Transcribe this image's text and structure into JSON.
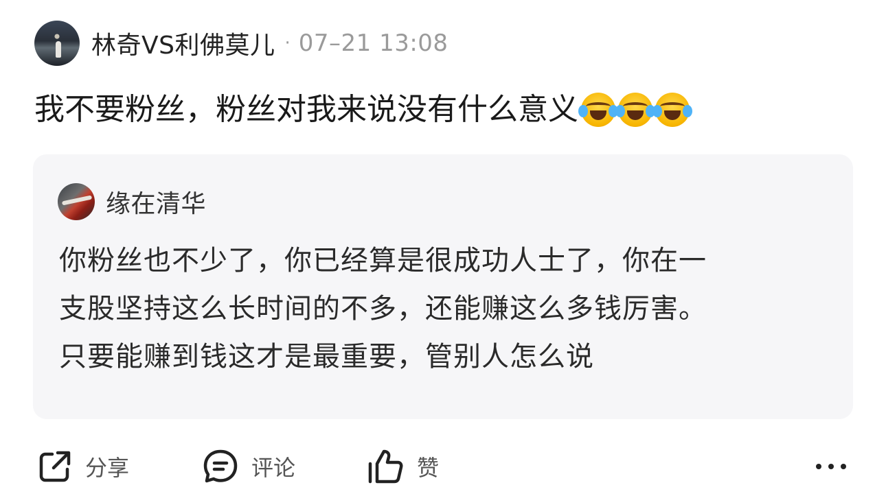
{
  "post": {
    "author": "林奇VS利佛莫儿",
    "separator": "·",
    "timestamp": "07–21 13:08",
    "text": "我不要粉丝，粉丝对我来说没有什么意义",
    "emojis": [
      "laughing-crying-emoji",
      "laughing-crying-emoji",
      "laughing-crying-emoji"
    ]
  },
  "quote": {
    "author": "缘在清华",
    "lines": [
      "你粉丝也不少了，你已经算是很成功人士了，你在一",
      "支股坚持这么长时间的不多，还能赚这么多钱厉害。",
      "只要能赚到钱这才是最重要，管别人怎么说"
    ]
  },
  "actions": {
    "share_label": "分享",
    "comment_label": "评论",
    "like_label": "赞",
    "share_icon": "share-icon",
    "comment_icon": "comment-icon",
    "like_icon": "thumbs-up-icon",
    "more_icon": "more-icon"
  },
  "colors": {
    "text": "#1a1a1a",
    "muted": "#9a9a9a",
    "card_bg": "#f6f6f8",
    "icon": "#222222"
  }
}
